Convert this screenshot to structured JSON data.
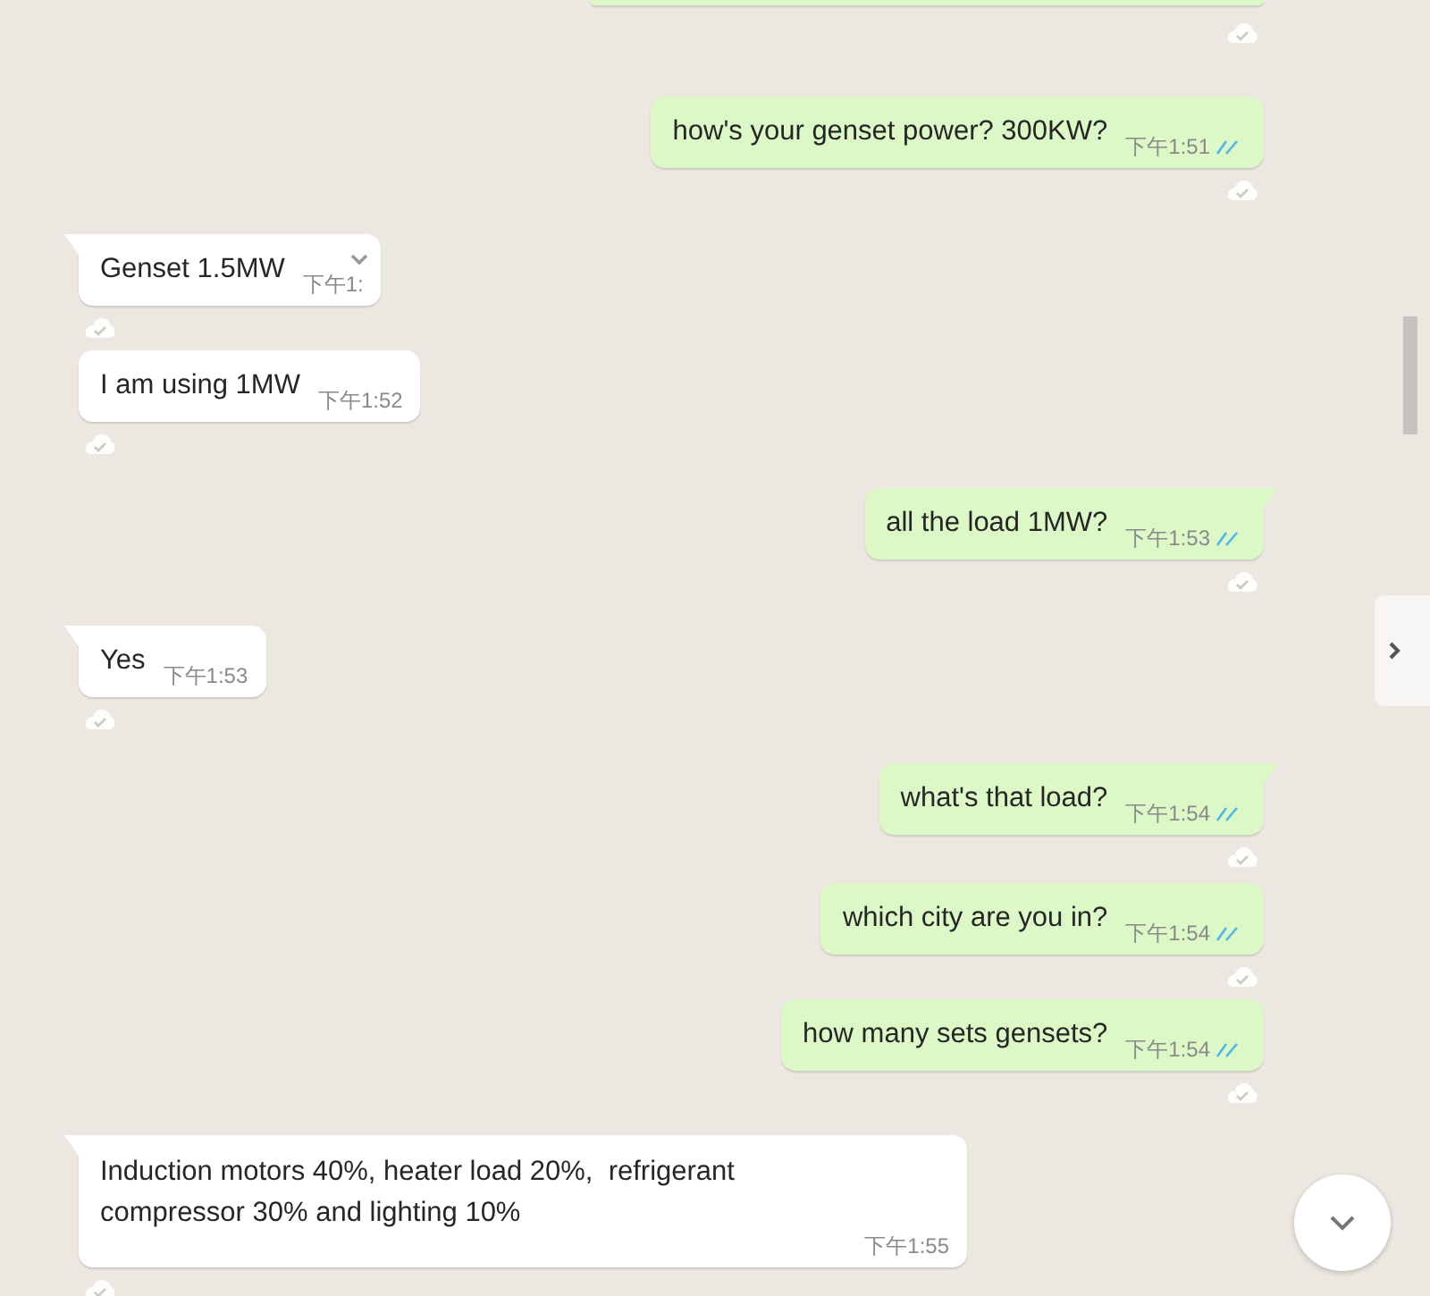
{
  "messages": [
    {
      "kind": "outgoing",
      "text": "how's your genset power? 300KW?",
      "time": "下午1:51",
      "read": true
    },
    {
      "kind": "incoming",
      "text": "Genset 1.5MW",
      "time": "下午1:",
      "menu_shown": true
    },
    {
      "kind": "incoming",
      "text": "I am using 1MW",
      "time": "下午1:52"
    },
    {
      "kind": "outgoing",
      "text": "all the load 1MW?",
      "time": "下午1:53",
      "read": true
    },
    {
      "kind": "incoming",
      "text": "Yes",
      "time": "下午1:53"
    },
    {
      "kind": "outgoing",
      "text": "what's that load?",
      "time": "下午1:54",
      "read": true
    },
    {
      "kind": "outgoing",
      "text": "which city are you in?",
      "time": "下午1:54",
      "read": true
    },
    {
      "kind": "outgoing",
      "text": "how many sets gensets?",
      "time": "下午1:54",
      "read": true
    },
    {
      "kind": "incoming",
      "text": "Induction motors 40%, heater load 20%,  refrigerant compressor 30% and lighting 10%",
      "time": "下午1:55"
    }
  ]
}
